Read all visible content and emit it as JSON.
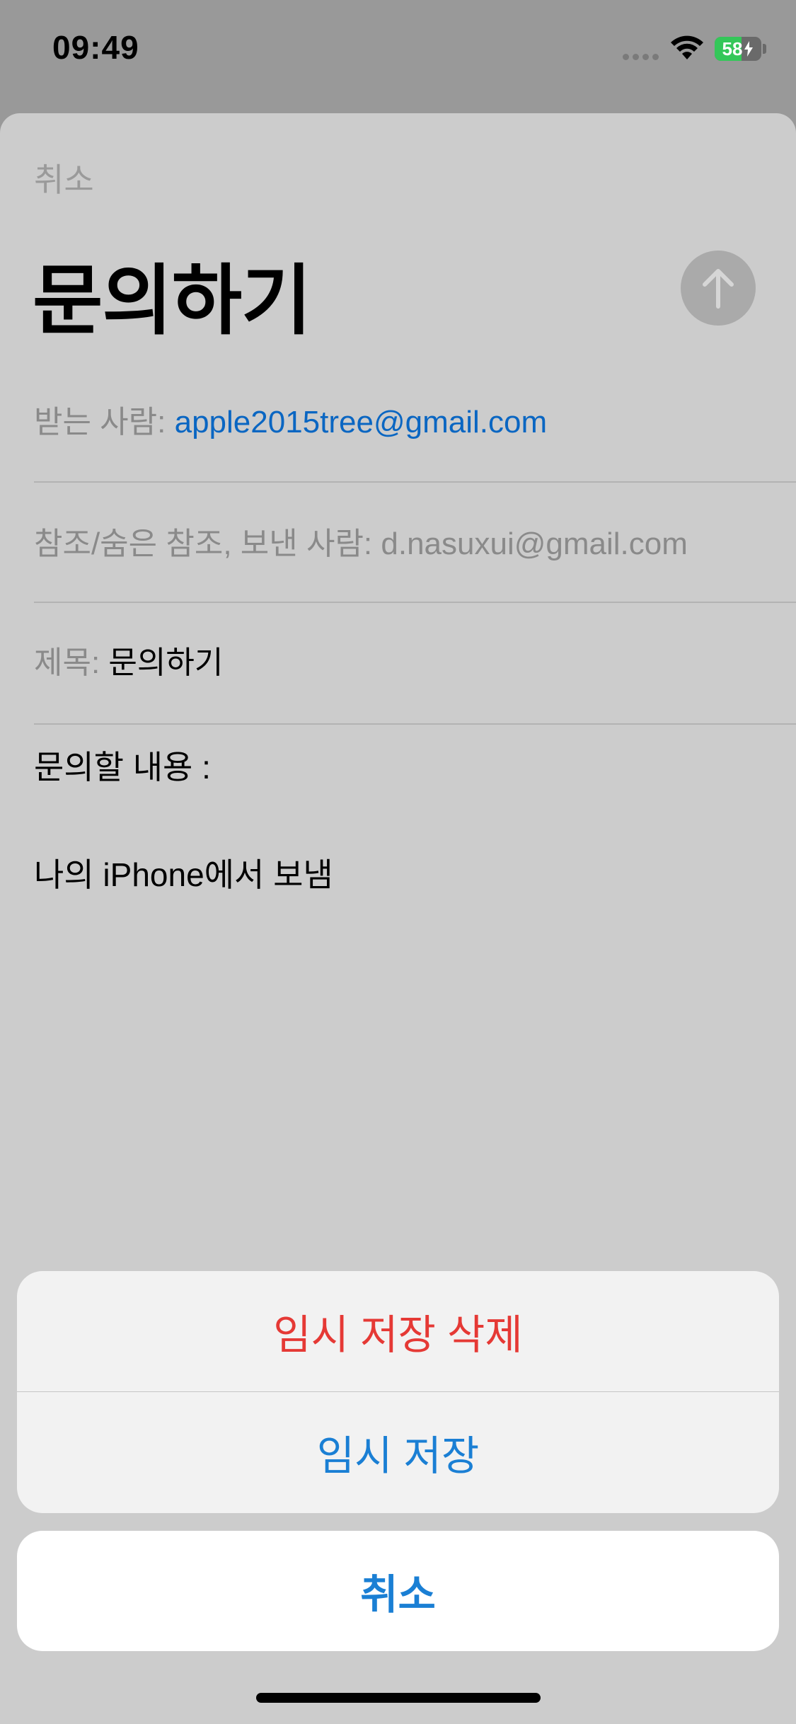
{
  "status_bar": {
    "time": "09:49",
    "battery_percent": 58,
    "battery_label": "58"
  },
  "compose": {
    "cancel_label": "취소",
    "title": "문의하기",
    "to_label": "받는 사람:",
    "to_value": "apple2015tree@gmail.com",
    "cc_label": "참조/숨은 참조, 보낸 사람:",
    "cc_value": "d.nasuxui@gmail.com",
    "subject_label": "제목:",
    "subject_value": "문의하기",
    "body_line1": "문의할 내용 :",
    "body_signature": "나의 iPhone에서 보냄"
  },
  "action_sheet": {
    "delete_draft_label": "임시 저장 삭제",
    "save_draft_label": "임시 저장",
    "cancel_label": "취소"
  },
  "colors": {
    "link_blue": "#0a66c2",
    "action_blue": "#1a7fd4",
    "destructive_red": "#e53935",
    "battery_green": "#34c759"
  },
  "icons": {
    "send": "arrow-up-icon",
    "wifi": "wifi-icon",
    "battery": "battery-icon",
    "signal": "cellular-signal-icon"
  }
}
